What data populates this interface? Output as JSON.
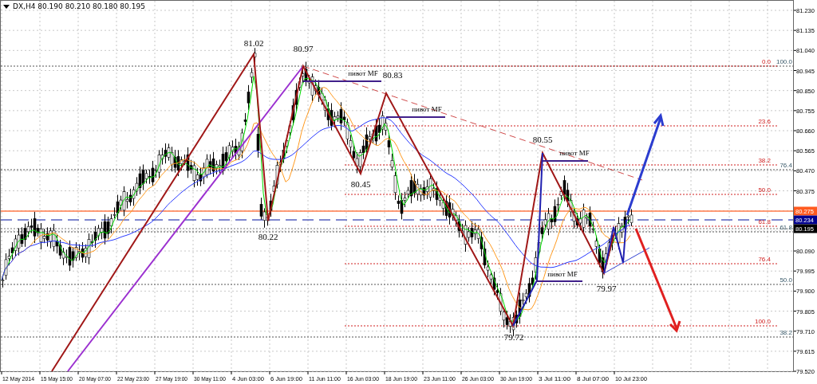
{
  "header": {
    "title": "DX,H4 80.190 80.210 80.180 80.195"
  },
  "price_axis": [
    {
      "label": "81.230",
      "kind": "tick"
    },
    {
      "label": "81.135",
      "kind": "tick"
    },
    {
      "label": "81.040",
      "kind": "tick"
    },
    {
      "label": "80.945",
      "kind": "tick"
    },
    {
      "label": "80.850",
      "kind": "tick"
    },
    {
      "label": "80.755",
      "kind": "tick"
    },
    {
      "label": "80.660",
      "kind": "tick"
    },
    {
      "label": "80.565",
      "kind": "tick"
    },
    {
      "label": "80.470",
      "kind": "tick"
    },
    {
      "label": "80.375",
      "kind": "tick"
    },
    {
      "label": "80.275",
      "kind": "badge",
      "color": "#ff5a1f"
    },
    {
      "label": "80.234",
      "kind": "badge",
      "color": "#000090"
    },
    {
      "label": "80.195",
      "kind": "badge",
      "color": "#000000"
    },
    {
      "label": "80.090",
      "kind": "tick"
    },
    {
      "label": "79.995",
      "kind": "tick"
    },
    {
      "label": "79.900",
      "kind": "tick"
    },
    {
      "label": "79.805",
      "kind": "tick"
    },
    {
      "label": "79.710",
      "kind": "tick"
    },
    {
      "label": "79.615",
      "kind": "tick"
    },
    {
      "label": "79.520",
      "kind": "tick"
    }
  ],
  "time_axis": [
    "12 May 2014",
    "15 May 15:00",
    "20 May 07:00",
    "22 May 23:00",
    "27 May 19:00",
    "30 May 11:00",
    "4 Jun 03:00",
    "6 Jun 19:00",
    "11 Jun 11:00",
    "16 Jun 03:00",
    "18 Jun 19:00",
    "23 Jun 11:00",
    "26 Jun 03:00",
    "30 Jun 19:00",
    "3 Jul 11:00",
    "8 Jul 07:00",
    "10 Jul 23:00"
  ],
  "price_labels": [
    "81.02",
    "80.97",
    "80.83",
    "80.45",
    "80.22",
    "80.55",
    "79.97",
    "79.72"
  ],
  "pivot_labels": [
    "пивот MF",
    "пивот MF",
    "пивот MF",
    "пивот MF"
  ],
  "fibonacci_retracement": [
    "0.0",
    "23.6",
    "38.2",
    "50.0",
    "61.8",
    "76.4",
    "100.0"
  ],
  "fibonacci_extension": [
    "100.0",
    "76.4",
    "61.8",
    "50.0",
    "38.2"
  ]
}
